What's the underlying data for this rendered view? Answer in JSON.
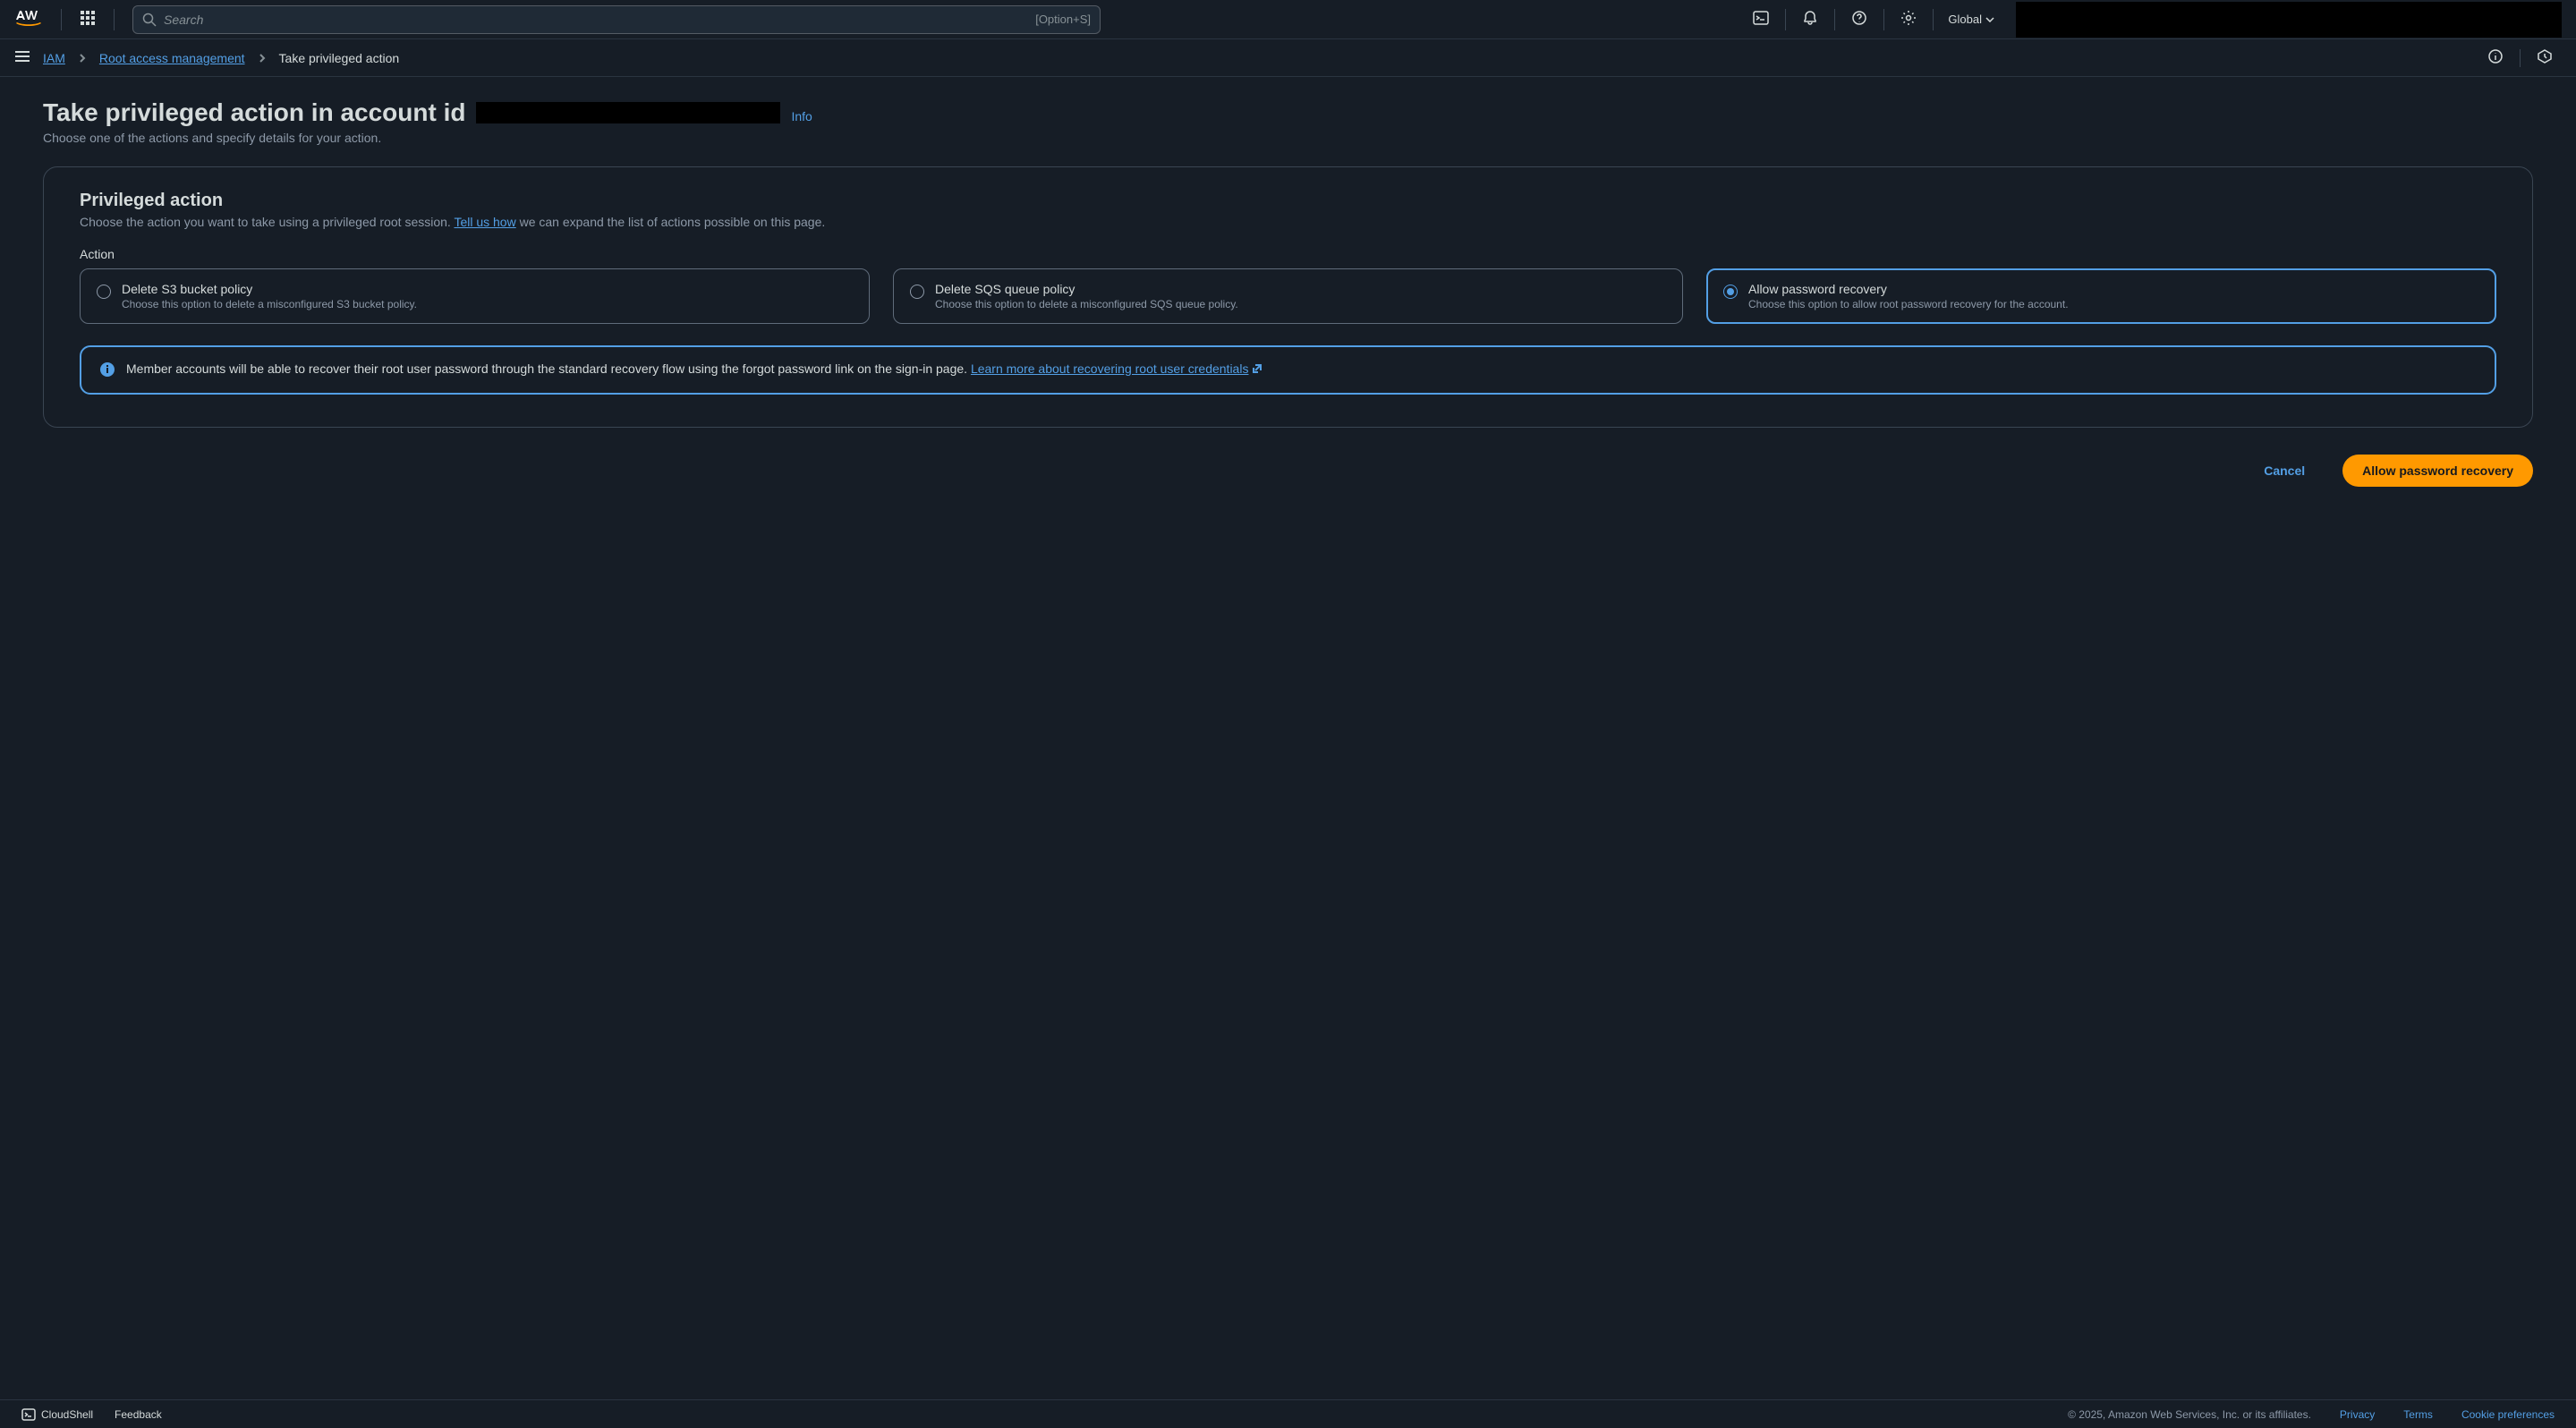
{
  "topnav": {
    "search_placeholder": "Search",
    "search_shortcut": "[Option+S]",
    "region": "Global"
  },
  "breadcrumb": {
    "items": [
      {
        "label": "IAM",
        "link": true
      },
      {
        "label": "Root access management",
        "link": true
      },
      {
        "label": "Take privileged action",
        "link": false
      }
    ]
  },
  "page": {
    "title_prefix": "Take privileged action in account id",
    "info_label": "Info",
    "subtitle": "Choose one of the actions and specify details for your action."
  },
  "panel": {
    "title": "Privileged action",
    "desc_before": "Choose the action you want to take using a privileged root session. ",
    "desc_link": "Tell us how",
    "desc_after": " we can expand the list of actions possible on this page.",
    "field_label": "Action",
    "options": [
      {
        "title": "Delete S3 bucket policy",
        "desc": "Choose this option to delete a misconfigured S3 bucket policy.",
        "selected": false
      },
      {
        "title": "Delete SQS queue policy",
        "desc": "Choose this option to delete a misconfigured SQS queue policy.",
        "selected": false
      },
      {
        "title": "Allow password recovery",
        "desc": "Choose this option to allow root password recovery for the account.",
        "selected": true
      }
    ]
  },
  "alert": {
    "text": "Member accounts will be able to recover their root user password through the standard recovery flow using the forgot password link on the sign-in page. ",
    "link": "Learn more about recovering root user credentials"
  },
  "actions": {
    "cancel": "Cancel",
    "primary": "Allow password recovery"
  },
  "footer": {
    "cloudshell": "CloudShell",
    "feedback": "Feedback",
    "copyright": "© 2025, Amazon Web Services, Inc. or its affiliates.",
    "privacy": "Privacy",
    "terms": "Terms",
    "cookie": "Cookie preferences"
  }
}
